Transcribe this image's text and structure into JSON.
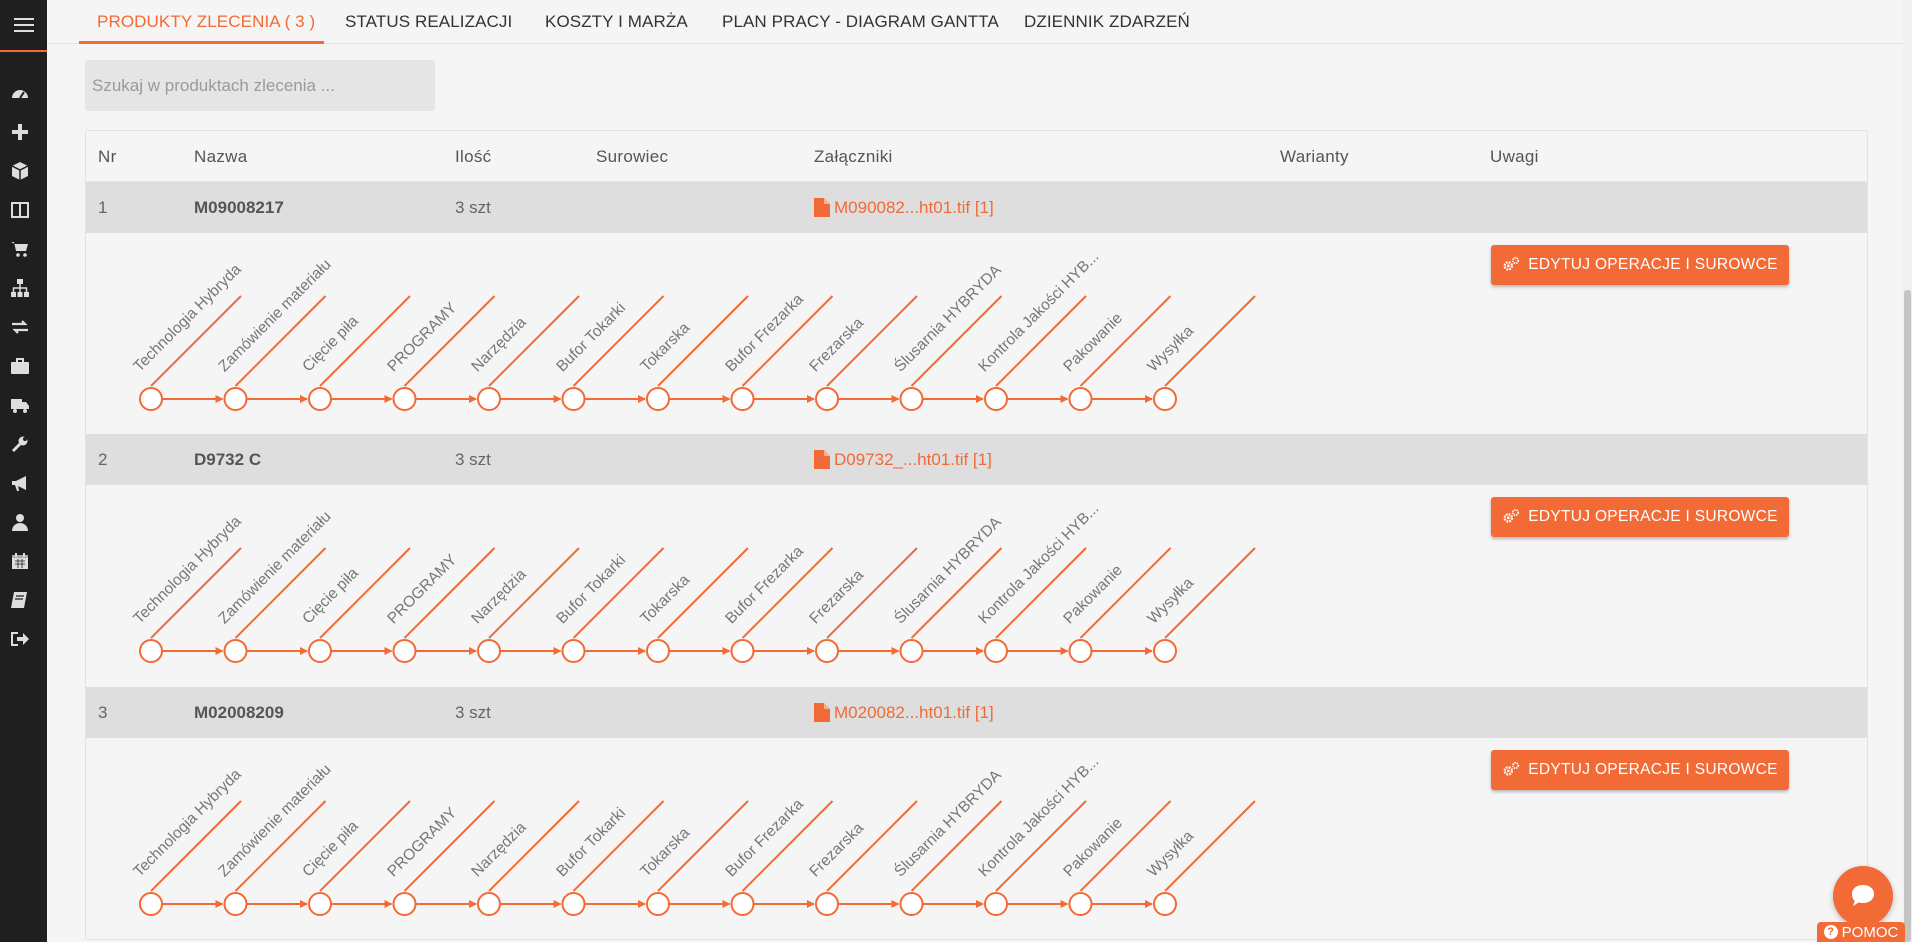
{
  "tabs": [
    {
      "label": "PRODUKTY ZLECENIA ( 3 )",
      "active": true
    },
    {
      "label": "STATUS REALIZACJI"
    },
    {
      "label": "KOSZTY I MARŻA"
    },
    {
      "label": "PLAN PRACY - DIAGRAM GANTTA"
    },
    {
      "label": "DZIENNIK ZDARZEŃ"
    }
  ],
  "search": {
    "placeholder": "Szukaj w produktach zlecenia ..."
  },
  "table": {
    "columns": [
      "Nr",
      "Nazwa",
      "Ilość",
      "Surowiec",
      "Załączniki",
      "Warianty",
      "Uwagi"
    ],
    "rows": [
      {
        "nr": "1",
        "name": "M09008217",
        "qty": "3 szt",
        "attachment": "M090082...ht01.tif [1]"
      },
      {
        "nr": "2",
        "name": "D9732 C",
        "qty": "3 szt",
        "attachment": "D09732_...ht01.tif [1]"
      },
      {
        "nr": "3",
        "name": "M02008209",
        "qty": "3 szt",
        "attachment": "M020082...ht01.tif [1]"
      }
    ],
    "operations": [
      "Technologia Hybryda",
      "Zamówienie materiału",
      "Cięcie piła",
      "PROGRAMY",
      "Narzędzia",
      "Bufor Tokarki",
      "Tokarska",
      "Bufor Frezarka",
      "Frezarska",
      "Ślusarnia HYBRYDA",
      "Kontrola Jakości HYB...",
      "Pakowanie",
      "Wysyłka"
    ],
    "edit_button_label": "EDYTUJ OPERACJE I SUROWCE"
  },
  "help": {
    "label": "POMOC"
  },
  "colors": {
    "accent": "#f26a35",
    "sidebar": "#1f1f1f"
  },
  "sidebar_icons": [
    "menu-icon",
    "dashboard-icon",
    "plus-icon",
    "box-icon",
    "columns-icon",
    "cart-icon",
    "sitemap-icon",
    "exchange-icon",
    "briefcase-icon",
    "truck-icon",
    "wrench-icon",
    "bullhorn-icon",
    "user-icon",
    "calendar-icon",
    "book-icon",
    "logout-icon"
  ]
}
